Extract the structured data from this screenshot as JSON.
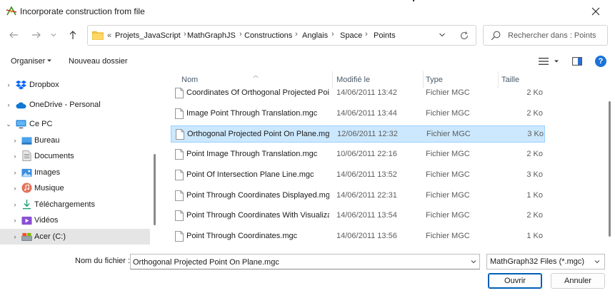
{
  "window": {
    "title": "Incorporate construction from file"
  },
  "address": {
    "overflow": "«",
    "crumbs": [
      "Projets_JavaScript",
      "MathGraphJS",
      "Constructions",
      "Anglais",
      "Space",
      "Points"
    ],
    "separator": "›"
  },
  "search": {
    "placeholder": "Rechercher dans : Points"
  },
  "toolbar": {
    "organize_label": "Organiser",
    "new_folder_label": "Nouveau dossier",
    "help_label": "?"
  },
  "sidebar": {
    "items": [
      {
        "label": "Dropbox",
        "icon": "dropbox-icon"
      },
      {
        "label": "OneDrive - Personal",
        "icon": "onedrive-icon"
      },
      {
        "label": "Ce PC",
        "icon": "pc-icon"
      },
      {
        "label": "Bureau",
        "icon": "desktop-folder-icon"
      },
      {
        "label": "Documents",
        "icon": "documents-folder-icon"
      },
      {
        "label": "Images",
        "icon": "pictures-folder-icon"
      },
      {
        "label": "Musique",
        "icon": "music-folder-icon"
      },
      {
        "label": "Téléchargements",
        "icon": "downloads-folder-icon"
      },
      {
        "label": "Vidéos",
        "icon": "videos-folder-icon"
      },
      {
        "label": "Acer (C:)",
        "icon": "drive-icon"
      }
    ]
  },
  "columns": {
    "name": "Nom",
    "modified": "Modifié le",
    "type": "Type",
    "size": "Taille"
  },
  "files": [
    {
      "name": "Coordinates Of Orthogonal Projected Poi...",
      "modified": "14/06/2011 13:42",
      "type": "Fichier MGC",
      "size": "2 Ko"
    },
    {
      "name": "Image Point Through Translation.mgc",
      "modified": "14/06/2011 13:44",
      "type": "Fichier MGC",
      "size": "2 Ko"
    },
    {
      "name": "Orthogonal Projected Point On Plane.mgc",
      "modified": "12/06/2011 12:32",
      "type": "Fichier MGC",
      "size": "3 Ko"
    },
    {
      "name": "Point Image Through Translation.mgc",
      "modified": "10/06/2011 22:16",
      "type": "Fichier MGC",
      "size": "2 Ko"
    },
    {
      "name": "Point Of Intersection Plane Line.mgc",
      "modified": "14/06/2011 13:52",
      "type": "Fichier MGC",
      "size": "3 Ko"
    },
    {
      "name": "Point Through Coordinates Displayed.mgc",
      "modified": "14/06/2011 22:31",
      "type": "Fichier MGC",
      "size": "1 Ko"
    },
    {
      "name": "Point Through Coordinates With Visualiza...",
      "modified": "14/06/2011 13:54",
      "type": "Fichier MGC",
      "size": "2 Ko"
    },
    {
      "name": "Point Through Coordinates.mgc",
      "modified": "14/06/2011 13:56",
      "type": "Fichier MGC",
      "size": "1 Ko"
    }
  ],
  "footer": {
    "filename_label": "Nom du fichier :",
    "filename_value": "Orthogonal Projected Point On Plane.mgc",
    "filter_value": "MathGraph32 Files (*.mgc)",
    "ok_label": "Ouvrir",
    "cancel_label": "Annuler"
  },
  "colors": {
    "accent": "#005fb8",
    "selection": "#cce8ff"
  }
}
